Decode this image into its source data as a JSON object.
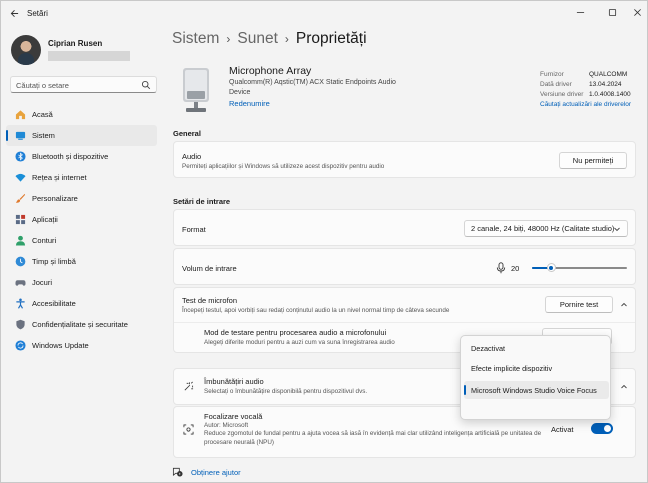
{
  "window": {
    "title": "Setări",
    "minimize_icon": "minimize-icon",
    "maximize_icon": "maximize-icon",
    "close_icon": "close-icon"
  },
  "user": {
    "name": "Ciprian Rusen"
  },
  "search": {
    "placeholder": "Căutați o setare"
  },
  "sidebar": {
    "items": [
      {
        "label": "Acasă",
        "icon": "home-icon",
        "color": "#e8a33d"
      },
      {
        "label": "Sistem",
        "icon": "system-monitor-icon",
        "color": "#1f8ad6",
        "active": true
      },
      {
        "label": "Bluetooth și dispozitive",
        "icon": "bluetooth-icon",
        "color": "#1f7fd6"
      },
      {
        "label": "Rețea și internet",
        "icon": "wifi-icon",
        "color": "#1a8fd8"
      },
      {
        "label": "Personalizare",
        "icon": "paint-brush-icon",
        "color": "#e07a2e"
      },
      {
        "label": "Aplicații",
        "icon": "apps-icon",
        "color": "#5a6b86"
      },
      {
        "label": "Conturi",
        "icon": "account-icon",
        "color": "#2fa06a"
      },
      {
        "label": "Timp și limbă",
        "icon": "globe-clock-icon",
        "color": "#2f8ad6"
      },
      {
        "label": "Jocuri",
        "icon": "gamepad-icon",
        "color": "#6b7280"
      },
      {
        "label": "Accesibilitate",
        "icon": "accessibility-icon",
        "color": "#1f6fc1"
      },
      {
        "label": "Confidențialitate și securitate",
        "icon": "shield-icon",
        "color": "#6b7280"
      },
      {
        "label": "Windows Update",
        "icon": "windows-update-icon",
        "color": "#1f7fd6"
      }
    ]
  },
  "breadcrumb": {
    "level1": "Sistem",
    "level2": "Sunet",
    "current": "Proprietăți",
    "separator": "›"
  },
  "device": {
    "name": "Microphone Array",
    "description": "Qualcomm(R) Aqstic(TM) ACX Static Endpoints Audio Device",
    "rename": "Redenumire",
    "icon": "microphone-device-icon"
  },
  "meta": {
    "rows": [
      {
        "key": "Furnizor",
        "value": "QUALCOMM"
      },
      {
        "key": "Dată driver",
        "value": "13.04.2024"
      },
      {
        "key": "Versiune driver",
        "value": "1.0.4008.1400"
      }
    ],
    "updates_link": "Căutați actualizări ale driverelor"
  },
  "general": {
    "section_title": "General",
    "audio_title": "Audio",
    "audio_sub": "Permiteți aplicațiilor și Windows să utilizeze acest dispozitiv pentru audio",
    "audio_button": "Nu permiteți"
  },
  "input": {
    "section_title": "Setări de intrare",
    "format_title": "Format",
    "format_value": "2 canale, 24 biți, 48000 Hz (Calitate studio)",
    "volume_title": "Volum de intrare",
    "volume_value": "20",
    "volume_level": 0.2,
    "test_title": "Test de microfon",
    "test_sub": "Începeți testul, apoi vorbiți sau redați conținutul audio la un nivel normal timp de câteva secunde",
    "test_button": "Pornire test",
    "mode_title": "Mod de testare pentru procesarea audio a microfonului",
    "mode_sub": "Alegeți diferite moduri pentru a auzi cum va suna înregistrarea audio"
  },
  "enhancements": {
    "title": "Îmbunătățiri audio",
    "sub": "Selectați o îmbunătățire disponibilă pentru dispozitivul dvs.",
    "voice_focus_title": "Focalizare vocală",
    "voice_focus_author": "Autor: Microsoft",
    "voice_focus_desc": "Reduce zgomotul de fundal pentru a ajuta vocea să iasă în evidență mai clar utilizând inteligența artificială pe unitatea de procesare neurală (NPU)",
    "voice_focus_state": "Activat",
    "voice_focus_on": true
  },
  "popup": {
    "items": [
      {
        "label": "Dezactivat"
      },
      {
        "label": "Efecte implicite dispozitiv"
      },
      {
        "label": "Microsoft Windows Studio Voice Focus",
        "selected": true
      }
    ]
  },
  "help": {
    "label": "Obținere ajutor"
  },
  "colors": {
    "accent": "#005fb8",
    "background": "#f3f3f3",
    "card": "#fbfbfb"
  }
}
